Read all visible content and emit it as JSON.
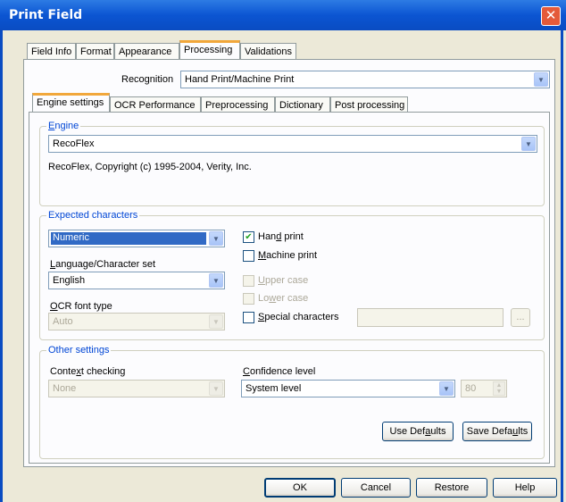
{
  "window": {
    "title": "Print Field"
  },
  "top_tabs": [
    "Field Info",
    "Format",
    "Appearance",
    "Processing",
    "Validations"
  ],
  "recognition": {
    "label": "Recognition",
    "value": "Hand Print/Machine Print"
  },
  "sub_tabs": [
    "Engine settings",
    "OCR Performance",
    "Preprocessing",
    "Dictionary",
    "Post processing"
  ],
  "engine": {
    "legend_prefix": "E",
    "legend_rest": "ngine",
    "value": "RecoFlex",
    "copyright": "RecoFlex, Copyright (c) 1995-2004, Verity, Inc."
  },
  "expected": {
    "legend": "Expected characters",
    "type_value": "Numeric",
    "language_label_a": "L",
    "language_label_b": "anguage/Character set",
    "language_value": "English",
    "ocr_label_a": "O",
    "ocr_label_b": "CR font type",
    "ocr_value": "Auto",
    "hand_a": "Han",
    "hand_u": "d",
    "hand_b": " print",
    "machine_a": "",
    "machine_u": "M",
    "machine_b": "achine print",
    "upper_a": "",
    "upper_u": "U",
    "upper_b": "pper case",
    "lower_a": "Lo",
    "lower_u": "w",
    "lower_b": "er case",
    "special_a": "",
    "special_u": "S",
    "special_b": "pecial characters",
    "browse_label": "...",
    "hand_checked": true,
    "machine_checked": false
  },
  "other": {
    "legend": "Other settings",
    "context_a": "Conte",
    "context_u": "x",
    "context_b": "t checking",
    "context_value": "None",
    "confidence_a": "",
    "confidence_u": "C",
    "confidence_b": "onfidence level",
    "confidence_value": "System level",
    "confidence_number": "80",
    "use_defaults_a": "Use Def",
    "use_defaults_u": "a",
    "use_defaults_b": "ults",
    "save_defaults_a": "Save Defa",
    "save_defaults_u": "u",
    "save_defaults_b": "lts"
  },
  "buttons": {
    "ok": "OK",
    "cancel": "Cancel",
    "restore": "Restore",
    "help": "Help"
  },
  "icons": {
    "close": "close-icon",
    "dropdown": "chevron-down-icon",
    "check": "checkmark-icon"
  },
  "colors": {
    "title_bar": "#0b55d2",
    "active_tab_accent": "#f1a73b",
    "selection": "#316ac5",
    "group_legend": "#0046d5"
  }
}
